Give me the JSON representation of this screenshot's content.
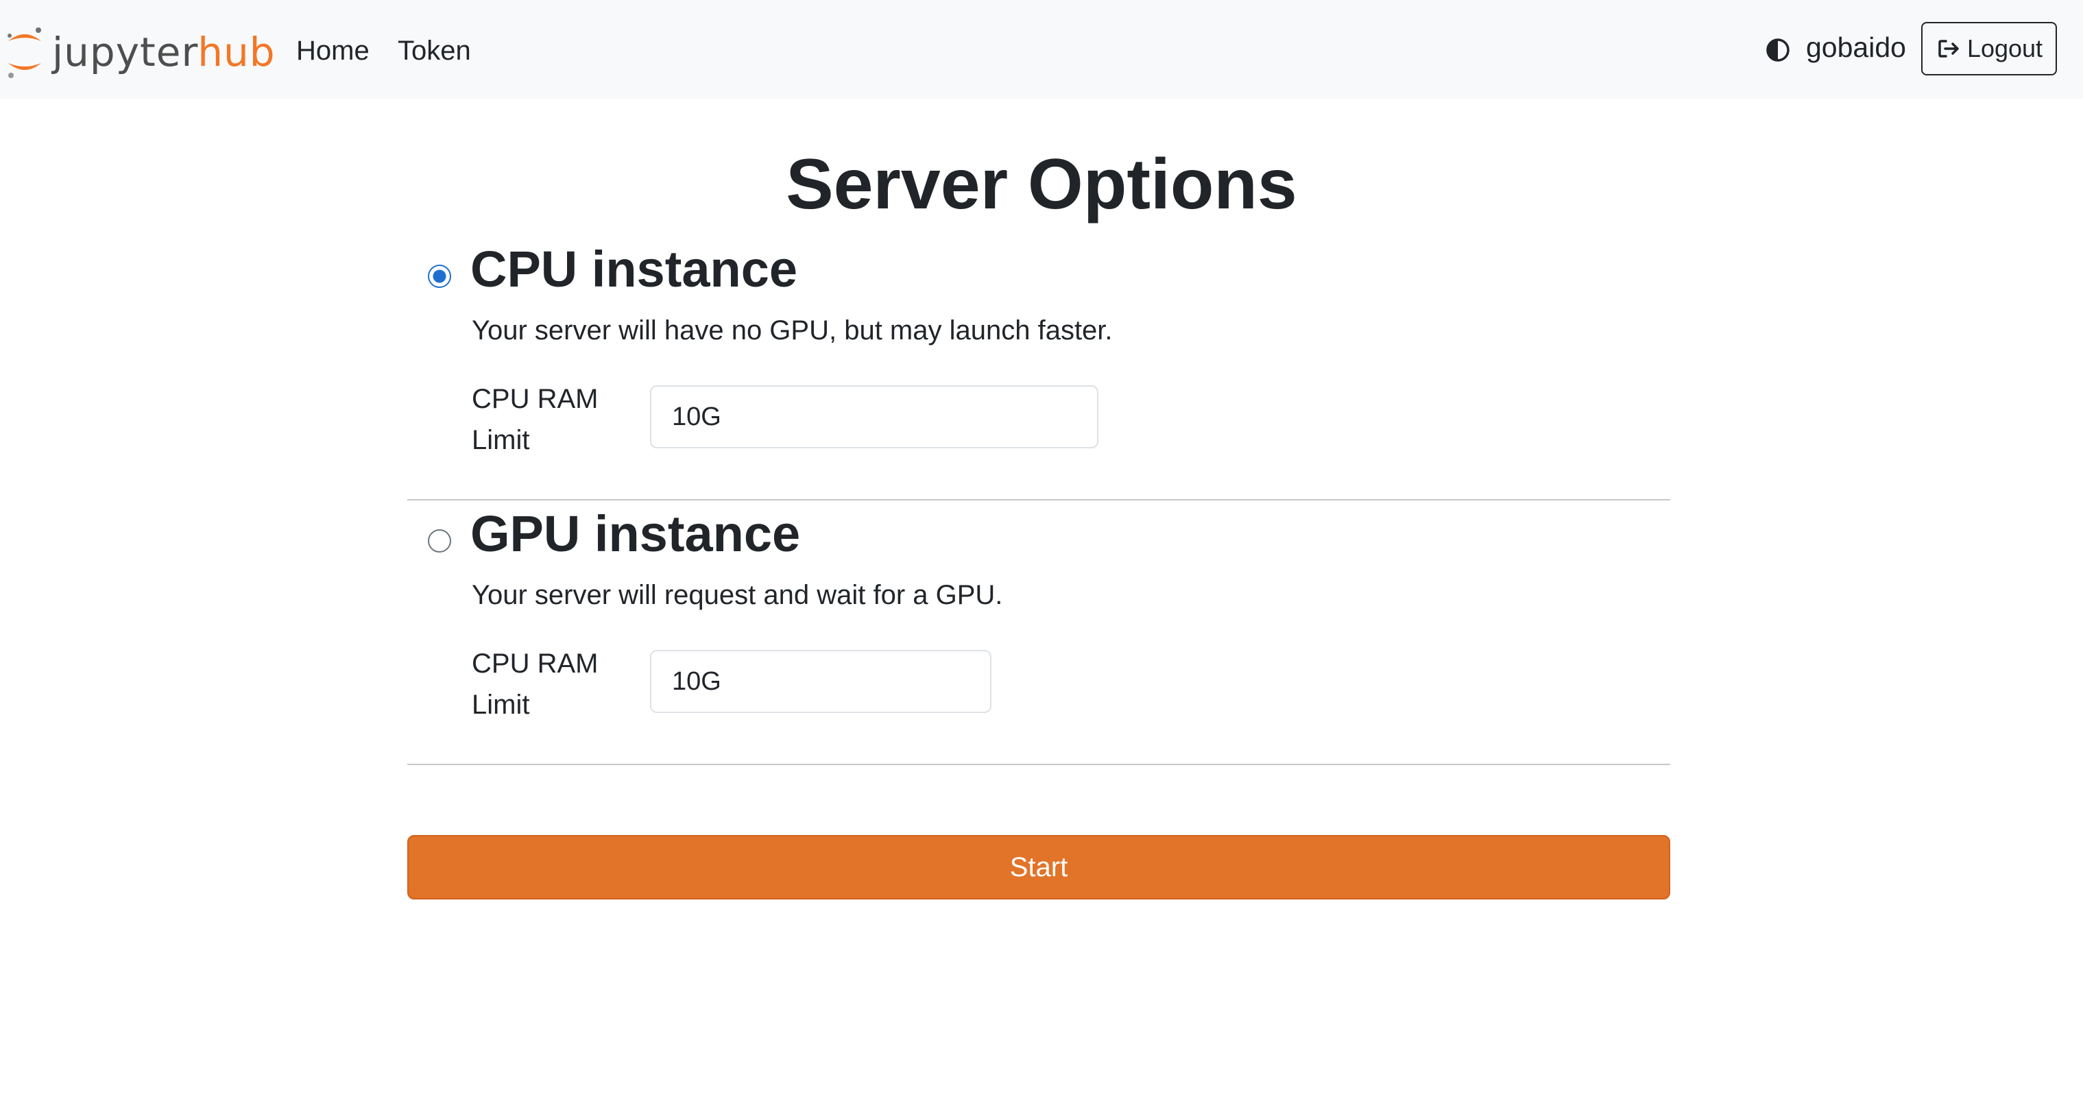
{
  "navbar": {
    "logo": {
      "part1": "jupyter",
      "part2": "hub"
    },
    "links": [
      {
        "label": "Home"
      },
      {
        "label": "Token"
      }
    ],
    "username": "gobaido",
    "logout_label": "Logout",
    "icons": {
      "theme": "contrast-icon",
      "logout": "logout-icon"
    }
  },
  "page": {
    "title": "Server Options",
    "options": [
      {
        "title": "CPU instance",
        "description": "Your server will have no GPU, but may launch faster.",
        "field_label_line1": "CPU RAM",
        "field_label_line2": "Limit",
        "field_value": "10G",
        "selected": true
      },
      {
        "title": "GPU instance",
        "description": "Your server will request and wait for a GPU.",
        "field_label_line1": "CPU RAM",
        "field_label_line2": "Limit",
        "field_value": "10G",
        "selected": false
      }
    ],
    "start_label": "Start"
  },
  "colors": {
    "brand_orange": "#f37726",
    "start_button": "#e2742a",
    "radio_selected": "#1f6fd0",
    "navbar_bg": "#f8f9fa"
  }
}
